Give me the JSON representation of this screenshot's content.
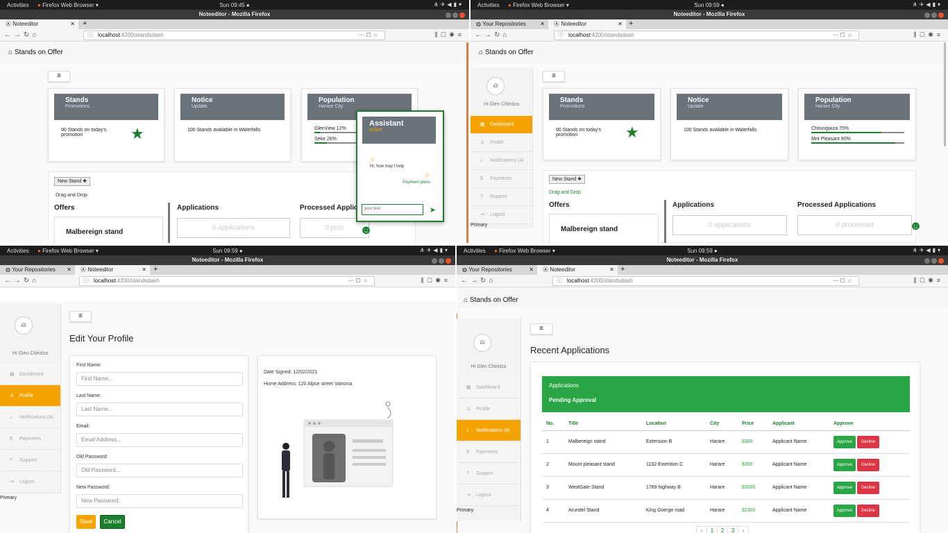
{
  "os": {
    "activities": "Activities",
    "app_name": "Firefox Web Browser",
    "clock_1": "Sun 09:45 ●",
    "clock_2": "Sun 09:59 ●"
  },
  "window_title": "Noteeditor - Mozilla Firefox",
  "tabs": {
    "repos": "Your Repositories",
    "noteeditor": "Noteeditor"
  },
  "url": {
    "host": "localhost",
    "path": ":4200/standsdash"
  },
  "page_title": "Stands on Offer",
  "user_greeting": "Hi Glen Chiridza",
  "sidebar": {
    "items": [
      {
        "label": "Dashboard",
        "icon": "dashboard-icon"
      },
      {
        "label": "Profile",
        "icon": "profile-icon"
      },
      {
        "label": "Notifications (4)",
        "icon": "bell-icon"
      },
      {
        "label": "Payments",
        "icon": "dollar-icon"
      },
      {
        "label": "Support",
        "icon": "help-icon"
      },
      {
        "label": "Logout",
        "icon": "logout-icon"
      }
    ],
    "primary": "Primary"
  },
  "cards": {
    "stands": {
      "title": "Stands",
      "sub": "Promotions",
      "text": "90 Stands on today's promotion"
    },
    "notice": {
      "title": "Notice",
      "sub": "Update",
      "text": "100 Stands available in Waterfalls"
    },
    "population": {
      "title": "Population",
      "sub": "Harare City"
    }
  },
  "population_q1": [
    {
      "label": "GlenView 12%",
      "value": 12
    },
    {
      "label": "Seke 26%",
      "value": 26
    }
  ],
  "population_q2": [
    {
      "label": "Chitungwiza 75%",
      "value": 75
    },
    {
      "label": "Mnt Pleasant 90%",
      "value": 90
    }
  ],
  "board": {
    "new_stand": "New Stand ✚",
    "drag_drop": "Drag and Drop",
    "offers": "Offers",
    "applications": "Applications",
    "processed": "Processed Applications",
    "processed_trunc": "Processed Applica",
    "offer_item": "Malbereign stand",
    "zero_apps": "0 applications",
    "zero_processed": "0 processed",
    "zero_proc_trunc": "0 proc"
  },
  "assistant": {
    "name": "Assistant",
    "status": "online",
    "greeting": "Hi, how may I help",
    "reply": "Payment plans",
    "placeholder": "your text"
  },
  "profile": {
    "title": "Edit Your Profile",
    "fields": [
      {
        "label": "First Name:",
        "placeholder": "First Name..."
      },
      {
        "label": "Last Name:",
        "placeholder": "Last Name..."
      },
      {
        "label": "Email:",
        "placeholder": "Email Address..."
      },
      {
        "label": "Old Password:",
        "placeholder": "Old Password..."
      },
      {
        "label": "New Password:",
        "placeholder": "New Password.."
      }
    ],
    "save": "Save",
    "cancel": "Cancel",
    "date_signed": "Date Signed: 12/02/2021",
    "address": "Home Address: 120 Alpse street Vainona"
  },
  "recent": {
    "title": "Recent Applications",
    "banner_title": "Applications",
    "banner_sub": "Pending Approval",
    "headers": [
      "No.",
      "Title",
      "Location",
      "City",
      "Price",
      "Applicant",
      "Approve"
    ],
    "rows": [
      [
        "1",
        "Malbereign stand",
        "Extension B",
        "Harare",
        "$300",
        "Applicant Name"
      ],
      [
        "2",
        "Mount pleasant stand",
        "1132 Extention C",
        "Harare",
        "$300",
        "Applicant Name"
      ],
      [
        "3",
        "WestGate Stand",
        "1789 highway B",
        "Harare",
        "$3000",
        "Applicant Name"
      ],
      [
        "4",
        "Arundel Stand",
        "King Goerge road",
        "Harare",
        "$2300",
        "Applicant Name"
      ]
    ],
    "approve": "Approve",
    "decline": "Decline",
    "pages": [
      "‹",
      "1",
      "2",
      "3",
      "›"
    ]
  },
  "colors": {
    "accent": "#f5a300",
    "green": "#1c7f2e",
    "header_gray": "#6a737a",
    "decline": "#dc3545"
  }
}
